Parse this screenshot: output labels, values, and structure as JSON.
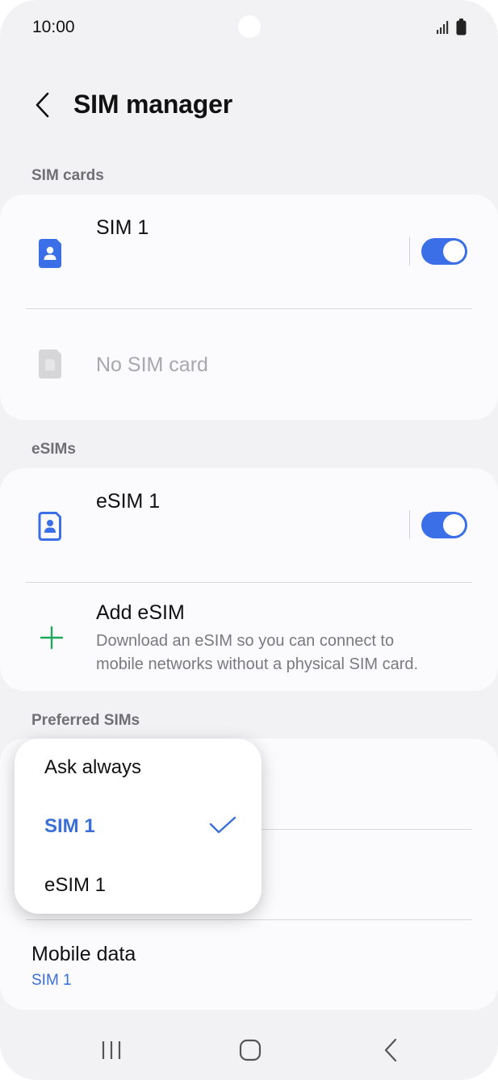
{
  "status_bar": {
    "time": "10:00"
  },
  "header": {
    "title": "SIM manager"
  },
  "sim_cards": {
    "section_label": "SIM cards",
    "sim1": {
      "label": "SIM 1",
      "enabled": true
    },
    "empty_slot": {
      "label": "No SIM card"
    }
  },
  "esims": {
    "section_label": "eSIMs",
    "esim1": {
      "label": "eSIM 1",
      "enabled": true
    },
    "add_esim": {
      "title": "Add eSIM",
      "description_line1": "Download an eSIM so you can connect to",
      "description_line2": "mobile networks without a physical SIM card."
    }
  },
  "preferred_sims": {
    "section_label": "Preferred SIMs",
    "mobile_data": {
      "title": "Mobile data",
      "value": "SIM 1"
    }
  },
  "dropdown": {
    "options": [
      "Ask always",
      "SIM 1",
      "eSIM 1"
    ],
    "selected": "SIM 1"
  },
  "colors": {
    "accent": "#3b6fe8",
    "sim_icon": "#3b6fe8",
    "add_icon": "#1fa85c",
    "selected_text": "#3a6fd8"
  }
}
